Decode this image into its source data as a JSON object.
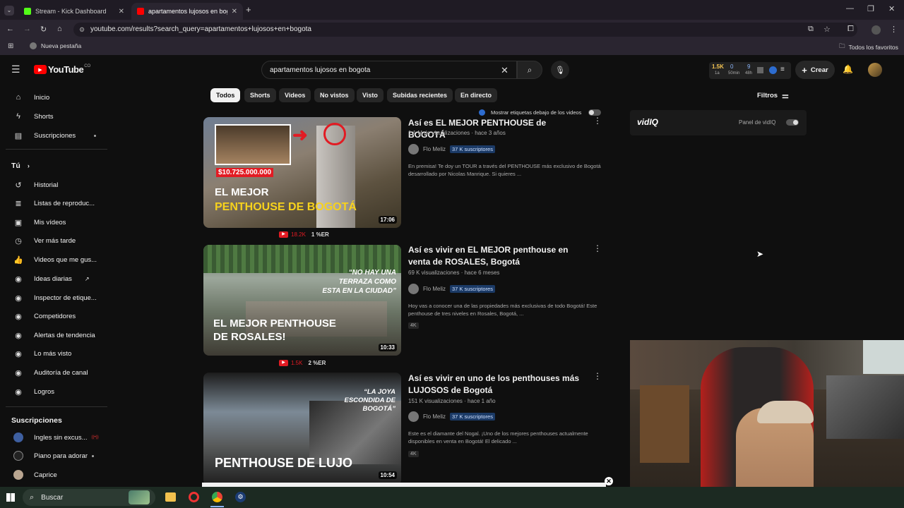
{
  "browser": {
    "tabs": [
      {
        "label": "Stream - Kick Dashboard"
      },
      {
        "label": "apartamentos lujosos en bogotá"
      }
    ],
    "url": "youtube.com/results?search_query=apartamentos+lujosos+en+bogota",
    "bookmark": "Nueva pestaña",
    "all_bookmarks": "Todos los favoritos"
  },
  "yt": {
    "logo": "YouTube",
    "logo_sup": "CO",
    "search_value": "apartamentos lujosos en bogota",
    "create_label": "Crear",
    "filters_label": "Filtros",
    "vidiq": {
      "stat1": "1.5K",
      "stat1_sub": "1a",
      "stat2": "0",
      "stat2_sub": "50min",
      "stat3": "9",
      "stat3_sub": "48h",
      "logo": "vidIQ",
      "panel_label": "Panel de vidIQ",
      "toggle_label": "Mostrar etiquetas debajo de los videos"
    },
    "chips": [
      "Todos",
      "Shorts",
      "Videos",
      "No vistos",
      "Visto",
      "Subidas recientes",
      "En directo"
    ],
    "sidebar": {
      "main": [
        "Inicio",
        "Shorts",
        "Suscripciones"
      ],
      "you_label": "Tú",
      "you": [
        "Historial",
        "Listas de reproduc...",
        "Mis vídeos",
        "Ver más tarde",
        "Videos que me gus...",
        "Ideas diarias",
        "Inspector de etique...",
        "Competidores",
        "Alertas de tendencia",
        "Lo más visto",
        "Auditoría de canal",
        "Logros"
      ],
      "subs_label": "Suscripciones",
      "subs": [
        "Ingles sin excus...",
        "Piano para adorar",
        "Caprice"
      ]
    },
    "videos": [
      {
        "title": "Así es EL MEJOR PENTHOUSE de BOGOTÁ",
        "meta": "1,1 M de visualizaciones · hace 3 años",
        "channel": "Flo Meliz",
        "subs": "37 K suscriptores",
        "desc": "En premisa! Te doy un TOUR a través del PENTHOUSE más exclusivo de Bogotá desarrollado por Nicolas Manrique. Si quieres ...",
        "duration": "17:06",
        "stat_views": "18.2K",
        "stat_er": "1 %ER",
        "thumb_top": "$10.725.000.000",
        "thumb_l1": "EL MEJOR",
        "thumb_l2": "PENTHOUSE DE BOGOTÁ",
        "badge": ""
      },
      {
        "title": "Así es vivir en EL MEJOR penthouse en venta de ROSALES, Bogotá",
        "meta": "69 K visualizaciones · hace 6 meses",
        "channel": "Flo Meliz",
        "subs": "37 K suscriptores",
        "desc": "Hoy vas a conocer una de las propiedades más exclusivas de todo Bogotá! Este penthouse de tres niveles en Rosales, Bogotá, ...",
        "duration": "10:33",
        "stat_views": "1.5K",
        "stat_er": "2 %ER",
        "thumb_top": "“NO HAY UNA TERRAZA COMO ESTA EN LA CIUDAD”",
        "thumb_l1": "EL MEJOR PENTHOUSE",
        "thumb_l2": "DE ROSALES!",
        "badge": "4K"
      },
      {
        "title": "Así es vivir en uno de los penthouses más LUJOSOS de Bogotá",
        "meta": "151 K visualizaciones · hace 1 año",
        "channel": "Flo Meliz",
        "subs": "37 K suscriptores",
        "desc": "Este es el diamante del Nogal. ¡Uno de los mejores penthouses actualmente disponibles en venta en Bogotá! El delicado ...",
        "duration": "10:54",
        "thumb_top": "“LA JOYA ESCONDIDA DE BOGOTÁ”",
        "thumb_l1": "",
        "thumb_l2": "PENTHOUSE DE LUJO",
        "badge": "4K"
      }
    ]
  },
  "taskbar": {
    "search_label": "Buscar"
  }
}
